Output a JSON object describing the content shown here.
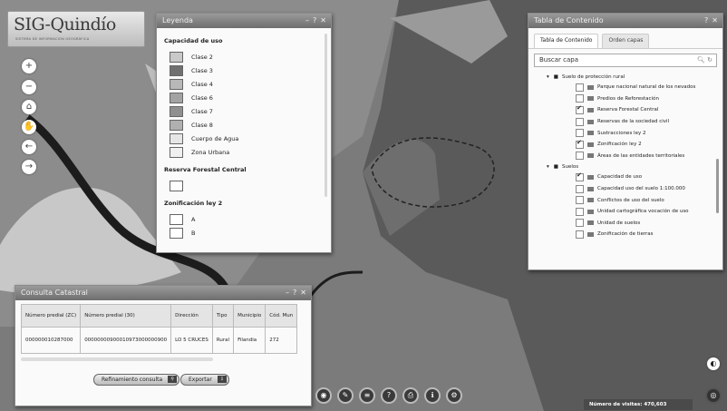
{
  "logo": {
    "title": "SIG-Quindío",
    "subtitle": "SISTEMA DE INFORMACIÓN GEOGRÁFICA"
  },
  "tools": {
    "zoom_in": "+",
    "zoom_out": "−",
    "home": "⌂",
    "pan": "✋",
    "back": "←",
    "forward": "→"
  },
  "legend": {
    "title": "Leyenda",
    "controls": [
      "–",
      "?",
      "✕"
    ],
    "section1": "Capacidad de uso",
    "classes": [
      {
        "label": "Clase 2",
        "color": "#c9c9c9"
      },
      {
        "label": "Clase 3",
        "color": "#707070"
      },
      {
        "label": "Clase 4",
        "color": "#b8b8b8"
      },
      {
        "label": "Clase 6",
        "color": "#a3a3a3"
      },
      {
        "label": "Clase 7",
        "color": "#8f8f8f"
      },
      {
        "label": "Clase 8",
        "color": "#b0b0b0"
      },
      {
        "label": "Cuerpo de Agua",
        "color": "#e6e6e6"
      },
      {
        "label": "Zona Urbana",
        "color": "#f0f0f0"
      }
    ],
    "section2": "Reserva Forestal Central",
    "section3": "Zonificación ley 2",
    "zones": [
      {
        "label": "A"
      },
      {
        "label": "B"
      }
    ]
  },
  "toc": {
    "title": "Tabla de Contenido",
    "controls": [
      "?",
      "✕"
    ],
    "tabs": [
      "Tabla de Contenido",
      "Orden capas"
    ],
    "search_placeholder": "Buscar capa",
    "group1": "Suelo de protección rural",
    "layers1": [
      {
        "label": "Parque nacional natural de los nevados",
        "checked": false
      },
      {
        "label": "Predios de Reforestación",
        "checked": false
      },
      {
        "label": "Reserva Forestal Central",
        "checked": true
      },
      {
        "label": "Reservas de la sociedad civil",
        "checked": false
      },
      {
        "label": "Sustracciones ley 2",
        "checked": false
      },
      {
        "label": "Zonificación ley 2",
        "checked": true
      },
      {
        "label": "Áreas de las entidades territoriales",
        "checked": false
      }
    ],
    "group2": "Suelos",
    "layers2": [
      {
        "label": "Capacidad de uso",
        "checked": true
      },
      {
        "label": "Capacidad uso del suelo 1:100.000",
        "checked": false
      },
      {
        "label": "Conflictos de uso del suelo",
        "checked": false
      },
      {
        "label": "Unidad cartográfica vocación de uso",
        "checked": false
      },
      {
        "label": "Unidad de suelos",
        "checked": false
      },
      {
        "label": "Zonificación de tierras",
        "checked": false
      }
    ]
  },
  "consulta": {
    "title": "Consulta Catastral",
    "controls": [
      "–",
      "?",
      "✕"
    ],
    "headers": [
      "Número predial (ZC)",
      "Número predial (30)",
      "Dirección",
      "Tipo",
      "Municipio",
      "Cód. Mun"
    ],
    "rows": [
      [
        "000000010287000",
        "00000000900010973000000900",
        "LO 5 CRUCES",
        "Rural",
        "Filandia",
        "272"
      ]
    ],
    "btn_refine": "Refinamiento consulta",
    "btn_export": "Exportar"
  },
  "status": {
    "visits_label": "Número de visitas:",
    "visits_value": "470,603"
  },
  "colors": {
    "header": "#7a7a7a",
    "map_dark": "#5f5f5f",
    "map_light": "#c8c8c8"
  }
}
